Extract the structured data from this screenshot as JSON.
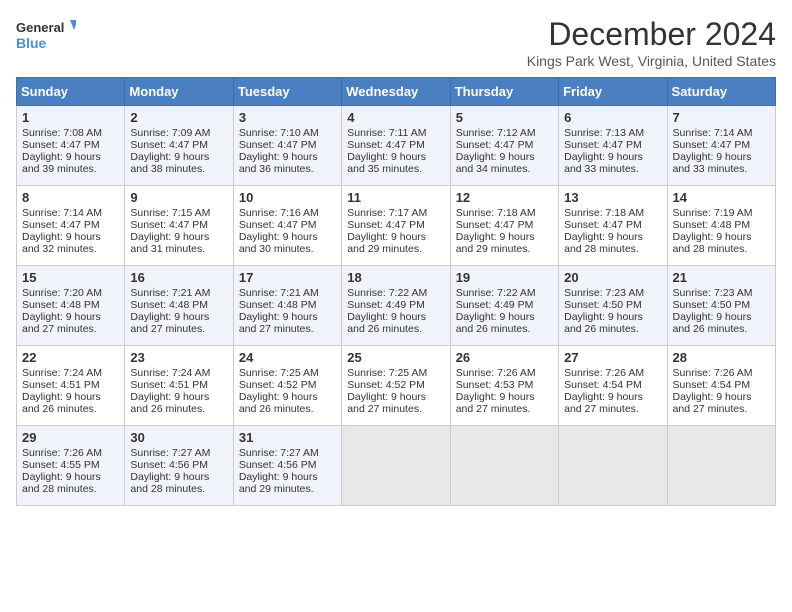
{
  "logo": {
    "line1": "General",
    "line2": "Blue"
  },
  "title": "December 2024",
  "location": "Kings Park West, Virginia, United States",
  "days_of_week": [
    "Sunday",
    "Monday",
    "Tuesday",
    "Wednesday",
    "Thursday",
    "Friday",
    "Saturday"
  ],
  "weeks": [
    [
      {
        "day": "1",
        "sunrise": "7:08 AM",
        "sunset": "4:47 PM",
        "daylight": "9 hours and 39 minutes."
      },
      {
        "day": "2",
        "sunrise": "7:09 AM",
        "sunset": "4:47 PM",
        "daylight": "9 hours and 38 minutes."
      },
      {
        "day": "3",
        "sunrise": "7:10 AM",
        "sunset": "4:47 PM",
        "daylight": "9 hours and 36 minutes."
      },
      {
        "day": "4",
        "sunrise": "7:11 AM",
        "sunset": "4:47 PM",
        "daylight": "9 hours and 35 minutes."
      },
      {
        "day": "5",
        "sunrise": "7:12 AM",
        "sunset": "4:47 PM",
        "daylight": "9 hours and 34 minutes."
      },
      {
        "day": "6",
        "sunrise": "7:13 AM",
        "sunset": "4:47 PM",
        "daylight": "9 hours and 33 minutes."
      },
      {
        "day": "7",
        "sunrise": "7:14 AM",
        "sunset": "4:47 PM",
        "daylight": "9 hours and 33 minutes."
      }
    ],
    [
      {
        "day": "8",
        "sunrise": "7:14 AM",
        "sunset": "4:47 PM",
        "daylight": "9 hours and 32 minutes."
      },
      {
        "day": "9",
        "sunrise": "7:15 AM",
        "sunset": "4:47 PM",
        "daylight": "9 hours and 31 minutes."
      },
      {
        "day": "10",
        "sunrise": "7:16 AM",
        "sunset": "4:47 PM",
        "daylight": "9 hours and 30 minutes."
      },
      {
        "day": "11",
        "sunrise": "7:17 AM",
        "sunset": "4:47 PM",
        "daylight": "9 hours and 29 minutes."
      },
      {
        "day": "12",
        "sunrise": "7:18 AM",
        "sunset": "4:47 PM",
        "daylight": "9 hours and 29 minutes."
      },
      {
        "day": "13",
        "sunrise": "7:18 AM",
        "sunset": "4:47 PM",
        "daylight": "9 hours and 28 minutes."
      },
      {
        "day": "14",
        "sunrise": "7:19 AM",
        "sunset": "4:48 PM",
        "daylight": "9 hours and 28 minutes."
      }
    ],
    [
      {
        "day": "15",
        "sunrise": "7:20 AM",
        "sunset": "4:48 PM",
        "daylight": "9 hours and 27 minutes."
      },
      {
        "day": "16",
        "sunrise": "7:21 AM",
        "sunset": "4:48 PM",
        "daylight": "9 hours and 27 minutes."
      },
      {
        "day": "17",
        "sunrise": "7:21 AM",
        "sunset": "4:48 PM",
        "daylight": "9 hours and 27 minutes."
      },
      {
        "day": "18",
        "sunrise": "7:22 AM",
        "sunset": "4:49 PM",
        "daylight": "9 hours and 26 minutes."
      },
      {
        "day": "19",
        "sunrise": "7:22 AM",
        "sunset": "4:49 PM",
        "daylight": "9 hours and 26 minutes."
      },
      {
        "day": "20",
        "sunrise": "7:23 AM",
        "sunset": "4:50 PM",
        "daylight": "9 hours and 26 minutes."
      },
      {
        "day": "21",
        "sunrise": "7:23 AM",
        "sunset": "4:50 PM",
        "daylight": "9 hours and 26 minutes."
      }
    ],
    [
      {
        "day": "22",
        "sunrise": "7:24 AM",
        "sunset": "4:51 PM",
        "daylight": "9 hours and 26 minutes."
      },
      {
        "day": "23",
        "sunrise": "7:24 AM",
        "sunset": "4:51 PM",
        "daylight": "9 hours and 26 minutes."
      },
      {
        "day": "24",
        "sunrise": "7:25 AM",
        "sunset": "4:52 PM",
        "daylight": "9 hours and 26 minutes."
      },
      {
        "day": "25",
        "sunrise": "7:25 AM",
        "sunset": "4:52 PM",
        "daylight": "9 hours and 27 minutes."
      },
      {
        "day": "26",
        "sunrise": "7:26 AM",
        "sunset": "4:53 PM",
        "daylight": "9 hours and 27 minutes."
      },
      {
        "day": "27",
        "sunrise": "7:26 AM",
        "sunset": "4:54 PM",
        "daylight": "9 hours and 27 minutes."
      },
      {
        "day": "28",
        "sunrise": "7:26 AM",
        "sunset": "4:54 PM",
        "daylight": "9 hours and 27 minutes."
      }
    ],
    [
      {
        "day": "29",
        "sunrise": "7:26 AM",
        "sunset": "4:55 PM",
        "daylight": "9 hours and 28 minutes."
      },
      {
        "day": "30",
        "sunrise": "7:27 AM",
        "sunset": "4:56 PM",
        "daylight": "9 hours and 28 minutes."
      },
      {
        "day": "31",
        "sunrise": "7:27 AM",
        "sunset": "4:56 PM",
        "daylight": "9 hours and 29 minutes."
      },
      null,
      null,
      null,
      null
    ]
  ]
}
